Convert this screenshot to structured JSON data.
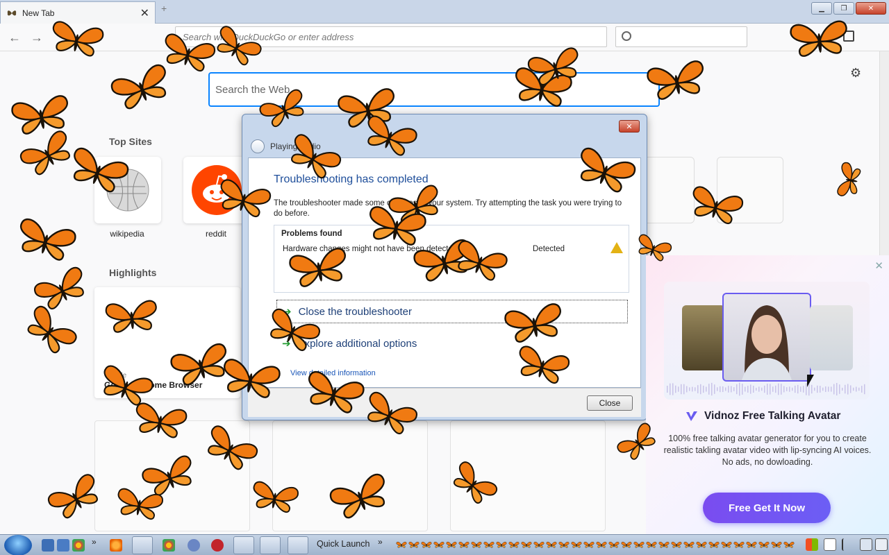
{
  "browser": {
    "tab_title": "New Tab",
    "tab_close": "✕",
    "new_tab_plus": "+",
    "url_placeholder": "Search with DuckDuckGo or enter address",
    "window_buttons": [
      "▁",
      "❐",
      "✕"
    ],
    "icons": [
      "back-arrow-icon",
      "forward-arrow-icon",
      "home-icon",
      "search-icon",
      "library-icon",
      "gear-icon"
    ]
  },
  "newtab": {
    "search_placeholder": "Search the Web",
    "top_sites_title": "Top Sites",
    "top_sites": [
      {
        "label": "wikipedia",
        "icon": "wikipedia-globe-icon"
      },
      {
        "label": "reddit",
        "icon": "reddit-alien-icon",
        "color": "#ff4500"
      }
    ],
    "highlights_title": "Highlights",
    "highlight": {
      "source": "Google",
      "title": "Google Chrome Browser"
    }
  },
  "dialog": {
    "nav_title": "Playing Audio",
    "heading": "Troubleshooting has completed",
    "description": "The troubleshooter made some changes to your system. Try attempting the task you were trying to do before.",
    "problems_header": "Problems found",
    "problem_item": "Hardware changes might not have been detected",
    "problem_status": "Detected",
    "link_close": "Close the troubleshooter",
    "link_explore": "Explore additional options",
    "detail_link": "View detailed information",
    "close_button": "Close",
    "close_x": "✕"
  },
  "ad": {
    "close": "✕",
    "brand": "Vidnoz Free Talking Avatar",
    "description": "100% free talking avatar generator for you to create realistic takling avatar video with lip-syncing AI voices. No ads, no dowloading.",
    "cta": "Free Get It Now",
    "accent": "#6a5cf0"
  },
  "taskbar": {
    "quick_launch": "Quick Launch",
    "more": "»"
  }
}
